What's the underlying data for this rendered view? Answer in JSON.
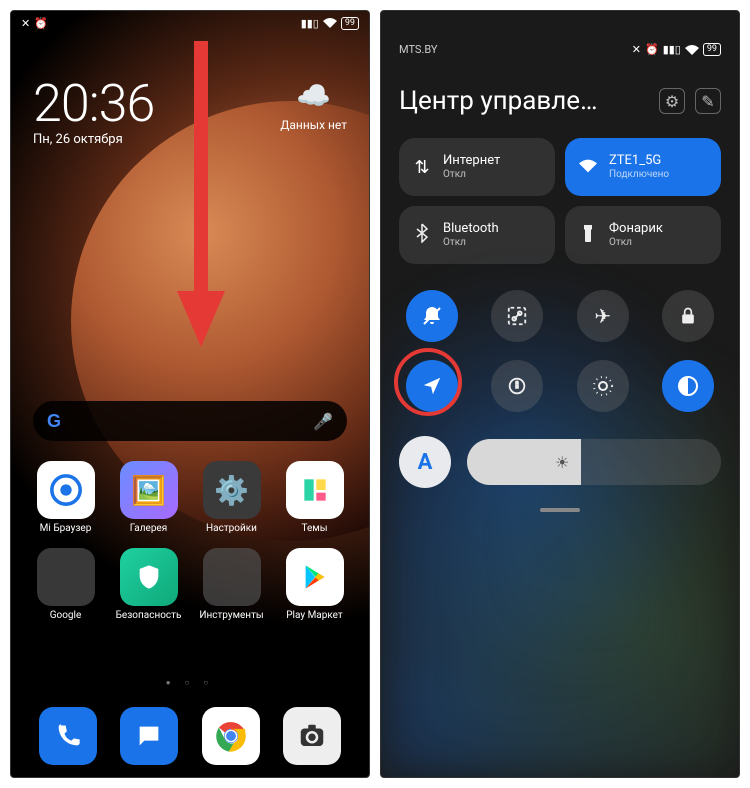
{
  "home": {
    "status": {
      "battery": "99"
    },
    "clock": {
      "time": "20:36",
      "date": "Пн, 26 октября"
    },
    "weather": {
      "label": "Данных нет"
    },
    "apps": [
      {
        "label": "Mi Браузер",
        "icon": "browser"
      },
      {
        "label": "Галерея",
        "icon": "gallery"
      },
      {
        "label": "Настройки",
        "icon": "settings"
      },
      {
        "label": "Темы",
        "icon": "themes"
      },
      {
        "label": "Google",
        "icon": "folder-google"
      },
      {
        "label": "Безопасность",
        "icon": "security"
      },
      {
        "label": "Инструменты",
        "icon": "folder-tools"
      },
      {
        "label": "Play Маркет",
        "icon": "play"
      }
    ],
    "dock": [
      {
        "icon": "phone"
      },
      {
        "icon": "messages"
      },
      {
        "icon": "chrome"
      },
      {
        "icon": "camera"
      }
    ]
  },
  "cc": {
    "carrier": "MTS.BY",
    "status": {
      "battery": "99"
    },
    "title": "Центр управле…",
    "tiles": [
      {
        "label": "Интернет",
        "sub": "Откл",
        "icon": "data",
        "active": false
      },
      {
        "label": "ZTE1_5G",
        "sub": "Подключено",
        "icon": "wifi",
        "active": true
      },
      {
        "label": "Bluetooth",
        "sub": "Откл",
        "icon": "bluetooth",
        "active": false
      },
      {
        "label": "Фонарик",
        "sub": "Откл",
        "icon": "flashlight",
        "active": false
      }
    ],
    "round": [
      {
        "icon": "mute",
        "active": true,
        "highlight": false
      },
      {
        "icon": "screenshot",
        "active": false,
        "highlight": false
      },
      {
        "icon": "airplane",
        "active": false,
        "highlight": false
      },
      {
        "icon": "lock",
        "active": false,
        "highlight": false
      },
      {
        "icon": "location",
        "active": true,
        "highlight": true
      },
      {
        "icon": "rotation",
        "active": false,
        "highlight": false
      },
      {
        "icon": "eye",
        "active": false,
        "highlight": false
      },
      {
        "icon": "darkmode",
        "active": true,
        "highlight": false
      }
    ],
    "auto_brightness": "A"
  }
}
